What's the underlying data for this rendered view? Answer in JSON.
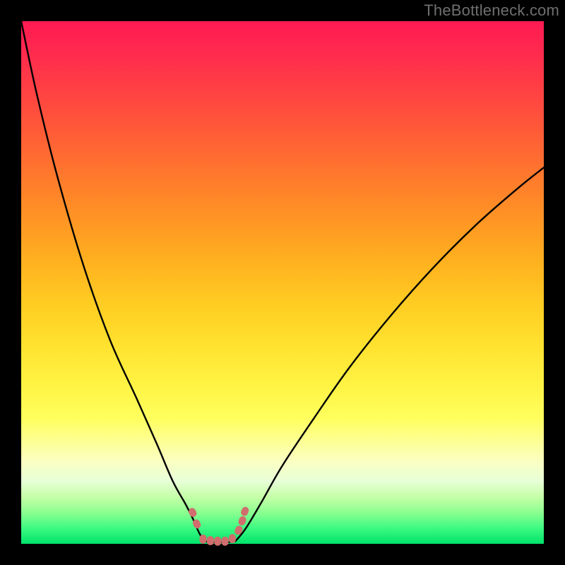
{
  "watermark": "TheBottleneck.com",
  "colors": {
    "frame_bg": "#000000",
    "curve_stroke": "#000000",
    "marker_fill": "#d16d6d",
    "watermark_text": "#6f6f6f"
  },
  "chart_data": {
    "type": "line",
    "title": "",
    "xlabel": "",
    "ylabel": "",
    "xlim": [
      0,
      100
    ],
    "ylim": [
      0,
      100
    ],
    "grid": false,
    "legend": false,
    "axes_shown": false,
    "gradient": [
      {
        "pos": 0,
        "hex": "#ff1a52"
      },
      {
        "pos": 50,
        "hex": "#ffcc22"
      },
      {
        "pos": 80,
        "hex": "#ffff5e"
      },
      {
        "pos": 100,
        "hex": "#00e26a"
      }
    ],
    "series": [
      {
        "name": "left_branch",
        "x": [
          0.0,
          3.0,
          7.0,
          12.0,
          17.0,
          22.0,
          26.0,
          29.0,
          31.5,
          33.0,
          34.0,
          35.0
        ],
        "y": [
          100.0,
          86.0,
          70.0,
          53.0,
          39.0,
          28.0,
          19.0,
          12.0,
          7.5,
          4.5,
          2.2,
          0.5
        ]
      },
      {
        "name": "right_branch",
        "x": [
          41.0,
          43.0,
          46.0,
          50.0,
          56.0,
          63.0,
          71.0,
          79.0,
          87.0,
          95.0,
          100.0
        ],
        "y": [
          0.5,
          3.0,
          8.0,
          15.0,
          24.0,
          34.0,
          44.0,
          53.0,
          61.0,
          68.0,
          72.0
        ]
      },
      {
        "name": "base",
        "x": [
          35.0,
          36.5,
          38.0,
          39.5,
          41.0
        ],
        "y": [
          0.5,
          0.3,
          0.3,
          0.3,
          0.5
        ]
      }
    ],
    "markers": {
      "name": "highlight_points",
      "shape": "pill",
      "x": [
        32.8,
        33.6,
        34.8,
        36.2,
        37.6,
        39.0,
        40.4,
        41.6,
        42.3,
        42.8
      ],
      "y": [
        6.0,
        3.8,
        0.9,
        0.6,
        0.5,
        0.5,
        1.0,
        2.6,
        4.4,
        6.2
      ]
    }
  }
}
